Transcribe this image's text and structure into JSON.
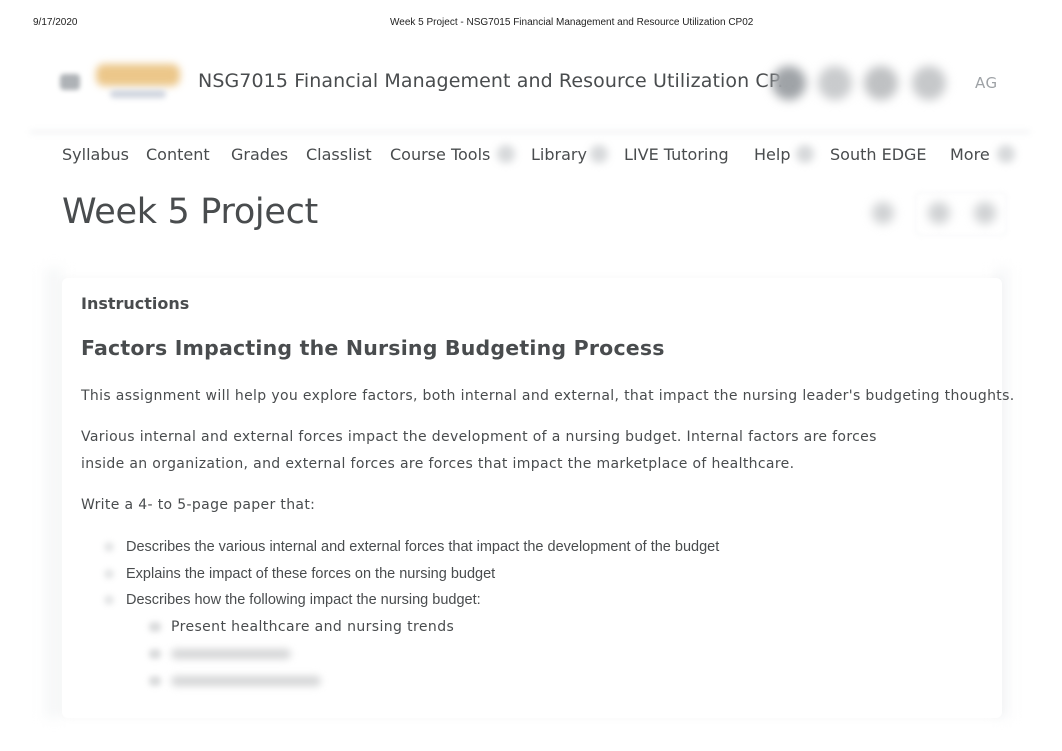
{
  "print_header": {
    "date": "9/17/2020",
    "title": "Week 5 Project - NSG7015 Financial Management and Resource Utilization CP02"
  },
  "topbar": {
    "icons": [
      "app-grid-icon",
      "message-icon",
      "mail-icon",
      "chat-icon",
      "notification-icon"
    ],
    "logo": "university-logo",
    "course_title": "NSG7015 Financial Management and Resource Utilization CP...",
    "user_initials": "AG"
  },
  "nav": {
    "items": [
      {
        "label": "Syllabus",
        "has_dropdown": false
      },
      {
        "label": "Content",
        "has_dropdown": false
      },
      {
        "label": "Grades",
        "has_dropdown": false
      },
      {
        "label": "Classlist",
        "has_dropdown": false
      },
      {
        "label": "Course Tools",
        "has_dropdown": true
      },
      {
        "label": "Library",
        "has_dropdown": true
      },
      {
        "label": "LIVE Tutoring",
        "has_dropdown": false
      },
      {
        "label": "Help",
        "has_dropdown": true
      },
      {
        "label": "South EDGE",
        "has_dropdown": false
      },
      {
        "label": "More",
        "has_dropdown": true
      }
    ]
  },
  "page": {
    "title": "Week 5 Project",
    "actions": [
      "print-icon",
      "previous-icon",
      "next-icon"
    ]
  },
  "content": {
    "section_label": "Instructions",
    "heading": "Factors Impacting the Nursing Budgeting Process",
    "paragraphs": [
      "This assignment will help you explore factors, both internal and external, that impact the nursing leader's budgeting thoughts.",
      "Various internal and external forces impact the development of a nursing budget. Internal factors are forces inside an organization, and external forces are forces that impact the marketplace of healthcare.",
      "Write a 4- to 5-page paper that:"
    ],
    "bullets": [
      "Describes the various internal and external forces that impact the development of the budget",
      "Explains the impact of these forces on the nursing budget",
      "Describes how the following impact the nursing budget:"
    ],
    "sub_bullets": [
      "Present healthcare and nursing trends",
      "",
      ""
    ]
  }
}
